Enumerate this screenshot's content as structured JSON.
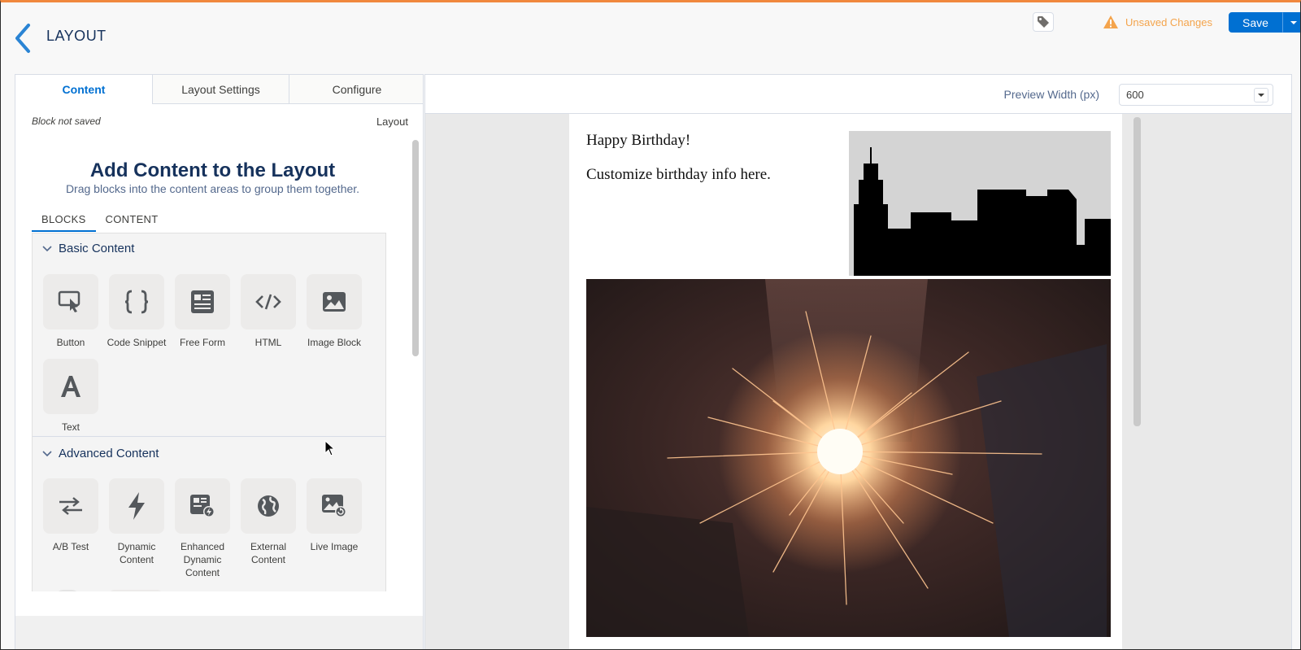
{
  "header": {
    "title": "LAYOUT",
    "unsaved_text": "Unsaved Changes",
    "save_label": "Save"
  },
  "left_panel": {
    "tabs": [
      {
        "label": "Content",
        "active": true
      },
      {
        "label": "Layout Settings",
        "active": false
      },
      {
        "label": "Configure",
        "active": false
      }
    ],
    "status": "Block not saved",
    "layout_label": "Layout",
    "heading": "Add Content to the Layout",
    "subheading": "Drag blocks into the content areas to group them together.",
    "subtabs": [
      {
        "label": "BLOCKS",
        "active": true
      },
      {
        "label": "CONTENT",
        "active": false
      }
    ],
    "basic": {
      "title": "Basic Content",
      "blocks": [
        {
          "label": "Button",
          "icon": "button-icon"
        },
        {
          "label": "Code Snippet",
          "icon": "code-snippet-icon"
        },
        {
          "label": "Free Form",
          "icon": "free-form-icon"
        },
        {
          "label": "HTML",
          "icon": "html-icon"
        },
        {
          "label": "Image Block",
          "icon": "image-icon"
        },
        {
          "label": "Text",
          "icon": "text-icon"
        }
      ]
    },
    "advanced": {
      "title": "Advanced Content",
      "blocks": [
        {
          "label": "A/B Test",
          "icon": "ab-test-icon"
        },
        {
          "label": "Dynamic Content",
          "icon": "lightning-icon"
        },
        {
          "label": "Enhanced Dynamic Content",
          "icon": "enhanced-dynamic-icon"
        },
        {
          "label": "External Content",
          "icon": "globe-icon"
        },
        {
          "label": "Live Image",
          "icon": "live-image-icon"
        }
      ]
    }
  },
  "preview": {
    "width_label": "Preview Width (px)",
    "width_value": "600",
    "email_line1": "Happy Birthday!",
    "email_line2": "Customize birthday info here."
  },
  "colors": {
    "accent": "#0070d2",
    "warning": "#f4a44c",
    "top_border": "#f0883e",
    "heading": "#16325c"
  }
}
